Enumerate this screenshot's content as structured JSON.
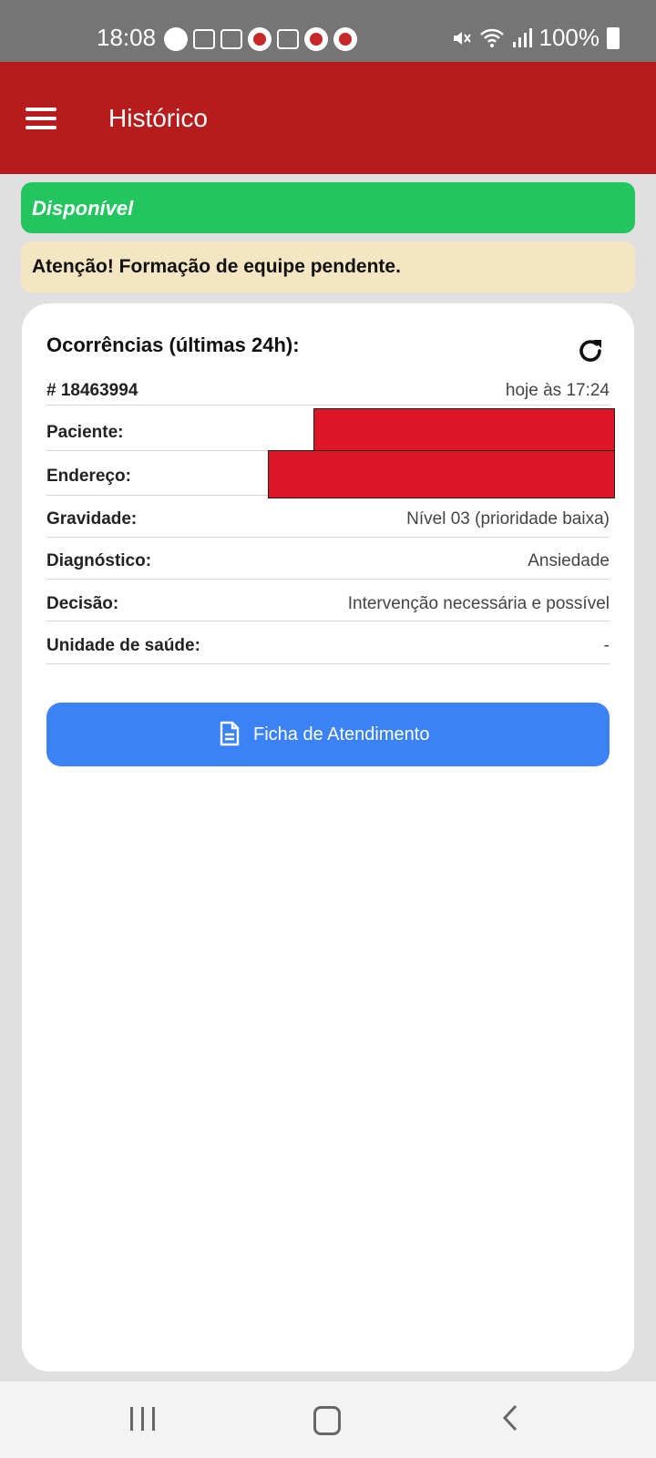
{
  "status_bar": {
    "time": "18:08",
    "battery": "100%",
    "icons_left": [
      "whatsapp-icon",
      "voicemail-icon",
      "missed-call-icon",
      "app-icon",
      "gallery-icon",
      "app-icon",
      "app-icon"
    ],
    "icons_right": [
      "mute-icon",
      "wifi-icon",
      "signal-icon",
      "battery-icon"
    ]
  },
  "app_bar": {
    "title": "Histórico",
    "color": "#b71c1c"
  },
  "status_banner": {
    "label": "Disponível",
    "color": "#22c55e"
  },
  "warning_banner": {
    "text": "Atenção! Formação de equipe pendente.",
    "color": "#f5e6c3"
  },
  "card": {
    "title": "Ocorrências (últimas 24h):",
    "occurrence": {
      "id": "# 18463994",
      "time": "hoje às 17:24"
    },
    "fields": {
      "paciente_label": "Paciente:",
      "endereco_label": "Endereço:",
      "gravidade_label": "Gravidade:",
      "gravidade_value": "Nível 03 (prioridade baixa)",
      "diagnostico_label": "Diagnóstico:",
      "diagnostico_value": "Ansiedade",
      "decisao_label": "Decisão:",
      "decisao_value": "Intervenção necessária e possível",
      "unidade_label": "Unidade de saúde:",
      "unidade_value": "-"
    },
    "button_label": "Ficha de Atendimento",
    "button_color": "#3b82f6"
  }
}
